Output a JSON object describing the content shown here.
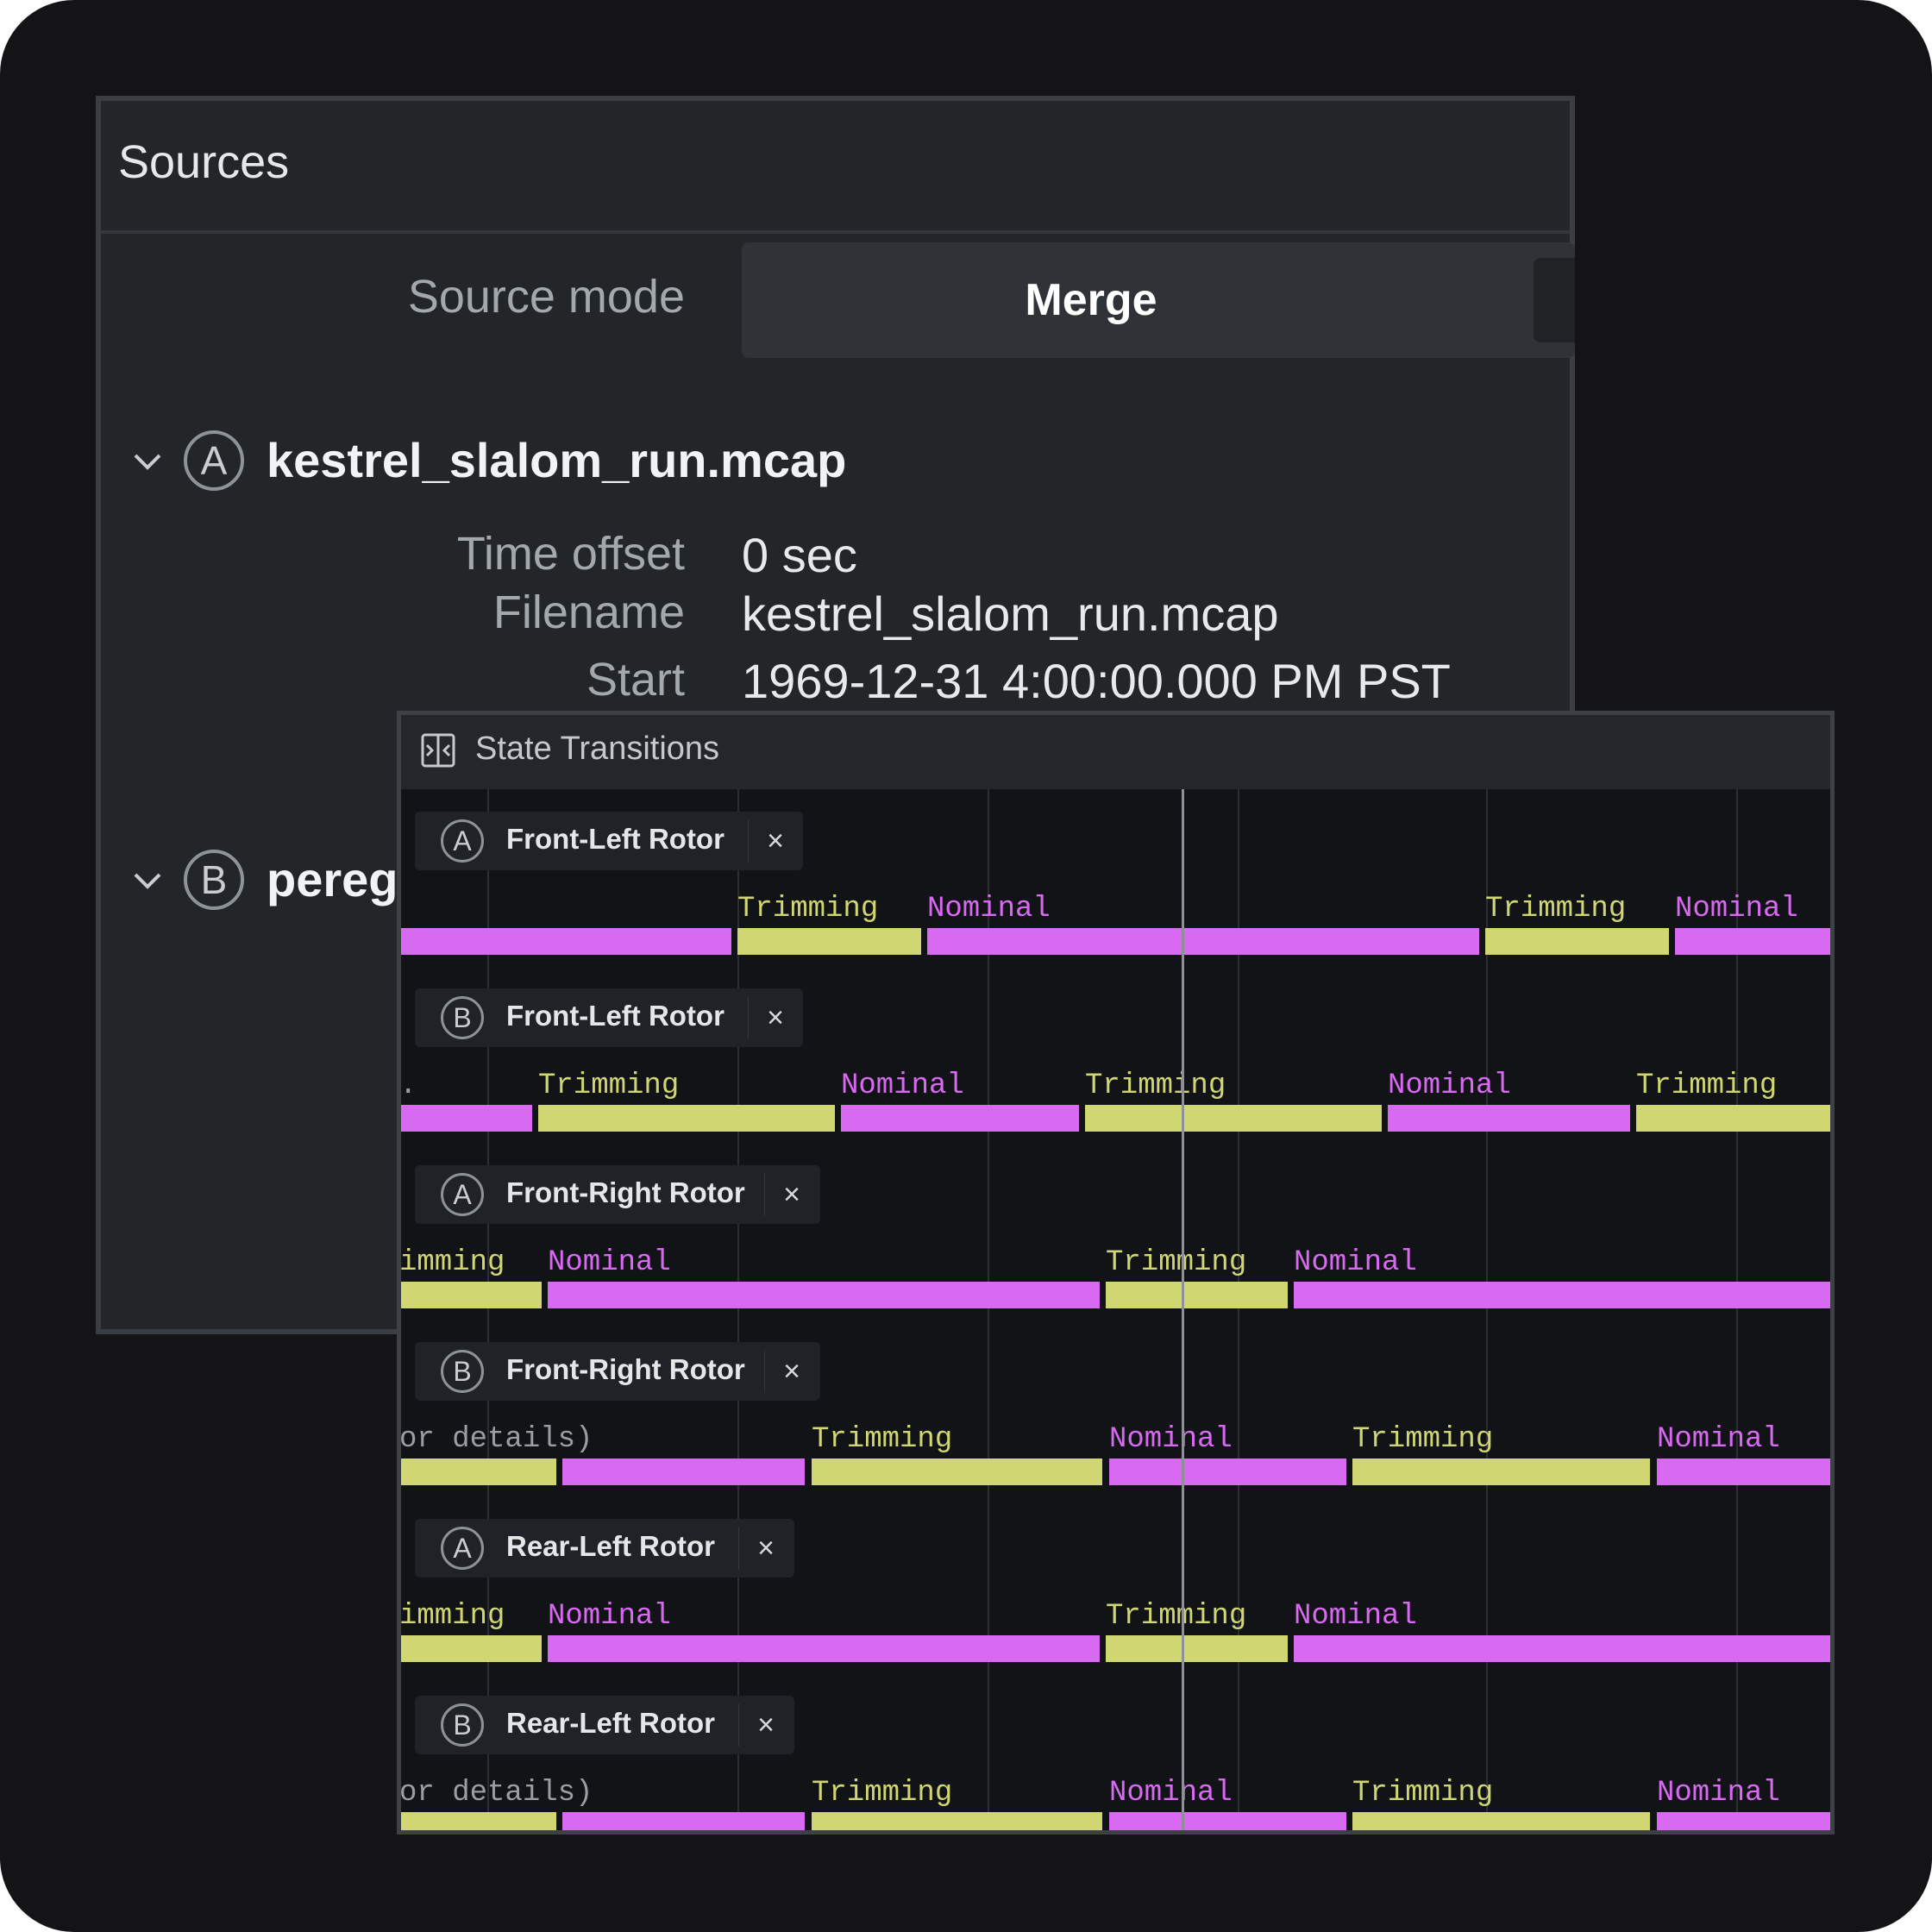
{
  "colors": {
    "trimming": "#cfd672",
    "nominal": "#d76af0",
    "muted": "#9a9ea3"
  },
  "sources": {
    "title": "Sources",
    "source_mode_label": "Source mode",
    "source_mode_value": "Merge",
    "a": {
      "badge": "A",
      "filename": "kestrel_slalom_run.mcap",
      "time_offset_label": "Time offset",
      "time_offset": "0 sec",
      "filename_label": "Filename",
      "filename_value": "kestrel_slalom_run.mcap",
      "start_label": "Start",
      "start": "1969-12-31 4:00:00.000 PM PST"
    },
    "b": {
      "badge": "B",
      "filename": "pereg"
    }
  },
  "state_transitions": {
    "title": "State Transitions",
    "icon": "state-transitions-icon",
    "close_glyph": "×",
    "rows": [
      {
        "badge": "A",
        "name": "Front-Left Rotor",
        "labels": [
          {
            "text": "Trimming",
            "state": "trimming"
          },
          {
            "text": "Nominal",
            "state": "nominal"
          },
          {
            "text": "Trimming",
            "state": "trimming"
          },
          {
            "text": "Nominal",
            "state": "nominal"
          }
        ]
      },
      {
        "badge": "B",
        "name": "Front-Left Rotor",
        "labels": [
          {
            "text": ".",
            "state": "muted"
          },
          {
            "text": "Trimming",
            "state": "trimming"
          },
          {
            "text": "Nominal",
            "state": "nominal"
          },
          {
            "text": "Trimming",
            "state": "trimming"
          },
          {
            "text": "Nominal",
            "state": "nominal"
          },
          {
            "text": "Trimming",
            "state": "trimming"
          }
        ]
      },
      {
        "badge": "A",
        "name": "Front-Right Rotor",
        "labels": [
          {
            "text": "imming",
            "state": "trimming"
          },
          {
            "text": "Nominal",
            "state": "nominal"
          },
          {
            "text": "Trimming",
            "state": "trimming"
          },
          {
            "text": "Nominal",
            "state": "nominal"
          }
        ]
      },
      {
        "badge": "B",
        "name": "Front-Right Rotor",
        "labels": [
          {
            "text": "or details)",
            "state": "muted"
          },
          {
            "text": "Trimming",
            "state": "trimming"
          },
          {
            "text": "Nominal",
            "state": "nominal"
          },
          {
            "text": "Trimming",
            "state": "trimming"
          },
          {
            "text": "Nominal",
            "state": "nominal"
          }
        ]
      },
      {
        "badge": "A",
        "name": "Rear-Left Rotor",
        "labels": [
          {
            "text": "imming",
            "state": "trimming"
          },
          {
            "text": "Nominal",
            "state": "nominal"
          },
          {
            "text": "Trimming",
            "state": "trimming"
          },
          {
            "text": "Nominal",
            "state": "nominal"
          }
        ]
      },
      {
        "badge": "B",
        "name": "Rear-Left Rotor",
        "labels": [
          {
            "text": "or details)",
            "state": "muted"
          },
          {
            "text": "Trimming",
            "state": "trimming"
          },
          {
            "text": "Nominal",
            "state": "nominal"
          },
          {
            "text": "Trimming",
            "state": "trimming"
          },
          {
            "text": "Nominal",
            "state": "nominal"
          }
        ]
      }
    ]
  }
}
